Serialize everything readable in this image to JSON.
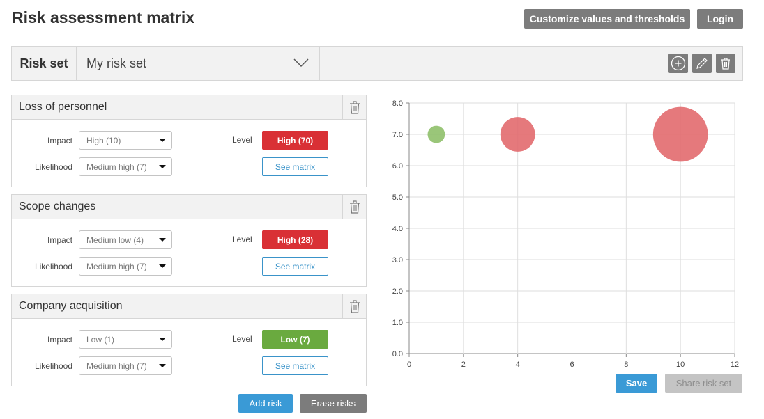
{
  "header": {
    "title": "Risk assessment matrix",
    "customize_label": "Customize values and thresholds",
    "login_label": "Login"
  },
  "riskset": {
    "label": "Risk set",
    "selected": "My risk set",
    "actions": [
      "add-circle-icon",
      "pencil-icon",
      "trash-icon"
    ]
  },
  "risks": [
    {
      "name": "Loss of personnel",
      "impact_label": "Impact",
      "impact": "High (10)",
      "likelihood_label": "Likelihood",
      "likelihood": "Medium high (7)",
      "level_label": "Level",
      "level": "High (70)",
      "level_color": "#d93035",
      "see_matrix": "See matrix"
    },
    {
      "name": "Scope changes",
      "impact_label": "Impact",
      "impact": "Medium low (4)",
      "likelihood_label": "Likelihood",
      "likelihood": "Medium high (7)",
      "level_label": "Level",
      "level": "High (28)",
      "level_color": "#d93035",
      "see_matrix": "See matrix"
    },
    {
      "name": "Company acquisition",
      "impact_label": "Impact",
      "impact": "Low (1)",
      "likelihood_label": "Likelihood",
      "likelihood": "Medium high (7)",
      "level_label": "Level",
      "level": "Low (7)",
      "level_color": "#6aaa3f",
      "see_matrix": "See matrix"
    }
  ],
  "actions": {
    "add_risk": "Add risk",
    "erase_risks": "Erase risks",
    "save": "Save",
    "share": "Share risk set"
  },
  "chart_data": {
    "type": "scatter",
    "subtype": "bubble",
    "title": "",
    "xlabel": "",
    "ylabel": "",
    "xlim": [
      0,
      12
    ],
    "ylim": [
      0,
      8
    ],
    "x_ticks": [
      "0",
      "2",
      "4",
      "6",
      "8",
      "10",
      "12"
    ],
    "y_ticks": [
      "0.0",
      "1.0",
      "2.0",
      "3.0",
      "4.0",
      "5.0",
      "6.0",
      "7.0",
      "8.0"
    ],
    "grid": true,
    "legend": "none",
    "points": [
      {
        "name": "Company acquisition",
        "x": 1,
        "y": 7,
        "size": 7,
        "color": "#8fc06a"
      },
      {
        "name": "Scope changes",
        "x": 4,
        "y": 7,
        "size": 28,
        "color": "#e26a6e"
      },
      {
        "name": "Loss of personnel",
        "x": 10,
        "y": 7,
        "size": 70,
        "color": "#e26a6e"
      }
    ]
  }
}
